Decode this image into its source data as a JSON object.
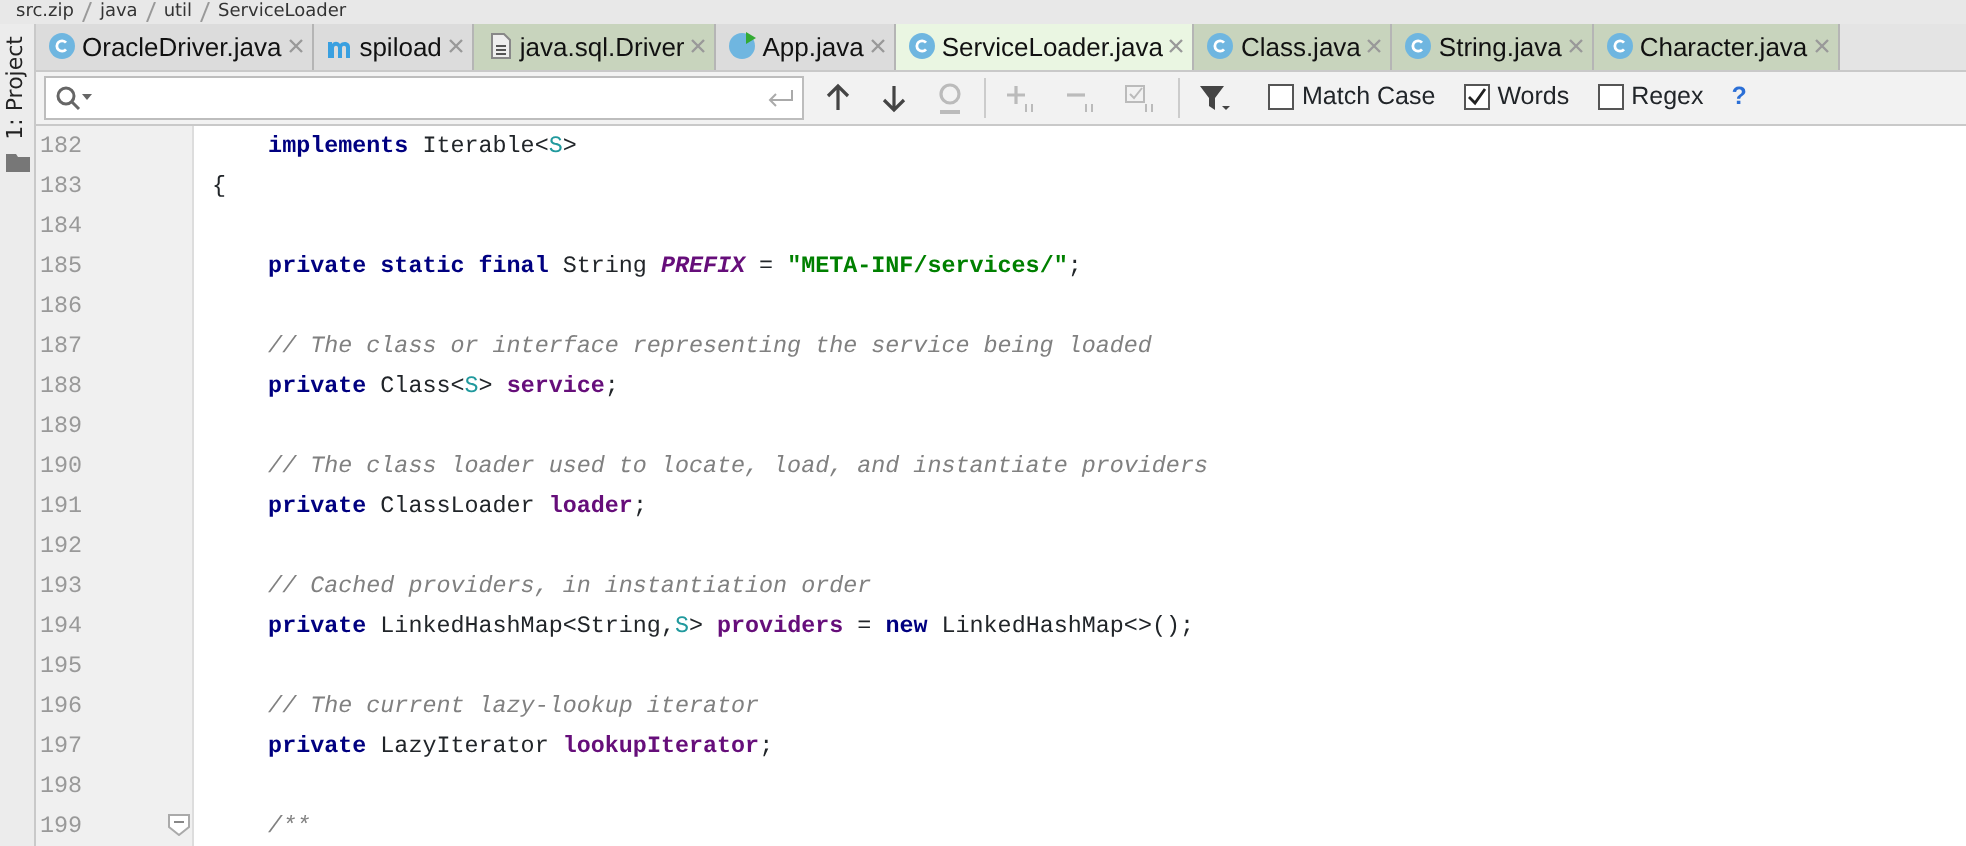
{
  "breadcrumbs": [
    "src.zip",
    "java",
    "util",
    "ServiceLoader"
  ],
  "tool_window_tab": "1: Project",
  "tabs": [
    {
      "label": "OracleDriver.java",
      "kind": "class",
      "library": false,
      "selected": false
    },
    {
      "label": "spiload",
      "kind": "module",
      "library": false,
      "selected": false
    },
    {
      "label": "java.sql.Driver",
      "kind": "file",
      "library": true,
      "selected": false
    },
    {
      "label": "App.java",
      "kind": "runnable",
      "library": false,
      "selected": false
    },
    {
      "label": "ServiceLoader.java",
      "kind": "class",
      "library": true,
      "selected": true
    },
    {
      "label": "Class.java",
      "kind": "class",
      "library": true,
      "selected": false
    },
    {
      "label": "String.java",
      "kind": "class",
      "library": true,
      "selected": false
    },
    {
      "label": "Character.java",
      "kind": "class",
      "library": true,
      "selected": false
    }
  ],
  "find_bar": {
    "options": [
      {
        "label": "Match Case",
        "checked": false
      },
      {
        "label": "Words",
        "checked": true
      },
      {
        "label": "Regex",
        "checked": false
      }
    ],
    "help": "?"
  },
  "editor": {
    "lines": [
      {
        "number": "182",
        "tokens": [
          {
            "kind": "kw",
            "t": "    implements"
          },
          {
            "kind": "plain",
            "t": " Iterable<"
          },
          {
            "kind": "generic",
            "t": "S"
          },
          {
            "kind": "plain",
            "t": ">"
          }
        ]
      },
      {
        "number": "183",
        "tokens": [
          {
            "kind": "plain",
            "t": "{"
          }
        ]
      },
      {
        "number": "184"
      },
      {
        "number": "185",
        "tokens": [
          {
            "kind": "kw",
            "t": "    private static final"
          },
          {
            "kind": "plain",
            "t": " String "
          },
          {
            "kind": "const",
            "t": "PREFIX"
          },
          {
            "kind": "plain",
            "t": " = "
          },
          {
            "kind": "str",
            "t": "\"META-INF/services/\""
          },
          {
            "kind": "plain",
            "t": ";"
          }
        ]
      },
      {
        "number": "186"
      },
      {
        "number": "187",
        "tokens": [
          {
            "kind": "comment",
            "t": "    // The class or interface representing the service being loaded"
          }
        ]
      },
      {
        "number": "188",
        "tokens": [
          {
            "kind": "kw",
            "t": "    private"
          },
          {
            "kind": "plain",
            "t": " Class<"
          },
          {
            "kind": "generic",
            "t": "S"
          },
          {
            "kind": "plain",
            "t": "> "
          },
          {
            "kind": "field",
            "t": "service"
          },
          {
            "kind": "plain",
            "t": ";"
          }
        ]
      },
      {
        "number": "189"
      },
      {
        "number": "190",
        "tokens": [
          {
            "kind": "comment",
            "t": "    // The class loader used to locate, load, and instantiate providers"
          }
        ]
      },
      {
        "number": "191",
        "tokens": [
          {
            "kind": "kw",
            "t": "    private"
          },
          {
            "kind": "plain",
            "t": " ClassLoader "
          },
          {
            "kind": "field",
            "t": "loader"
          },
          {
            "kind": "plain",
            "t": ";"
          }
        ]
      },
      {
        "number": "192"
      },
      {
        "number": "193",
        "tokens": [
          {
            "kind": "comment",
            "t": "    // Cached providers, in instantiation order"
          }
        ]
      },
      {
        "number": "194",
        "tokens": [
          {
            "kind": "kw",
            "t": "    private"
          },
          {
            "kind": "plain",
            "t": " LinkedHashMap<String,"
          },
          {
            "kind": "generic",
            "t": "S"
          },
          {
            "kind": "plain",
            "t": "> "
          },
          {
            "kind": "field",
            "t": "providers"
          },
          {
            "kind": "plain",
            "t": " = "
          },
          {
            "kind": "kw",
            "t": "new"
          },
          {
            "kind": "plain",
            "t": " LinkedHashMap<>();"
          }
        ]
      },
      {
        "number": "195"
      },
      {
        "number": "196",
        "tokens": [
          {
            "kind": "comment",
            "t": "    // The current lazy-lookup iterator"
          }
        ]
      },
      {
        "number": "197",
        "tokens": [
          {
            "kind": "kw",
            "t": "    private"
          },
          {
            "kind": "plain",
            "t": " LazyIterator "
          },
          {
            "kind": "field",
            "t": "lookupIterator"
          },
          {
            "kind": "plain",
            "t": ";"
          }
        ]
      },
      {
        "number": "198"
      },
      {
        "number": "199",
        "fold": true,
        "tokens": [
          {
            "kind": "comment",
            "t": "    /**"
          }
        ]
      }
    ]
  }
}
